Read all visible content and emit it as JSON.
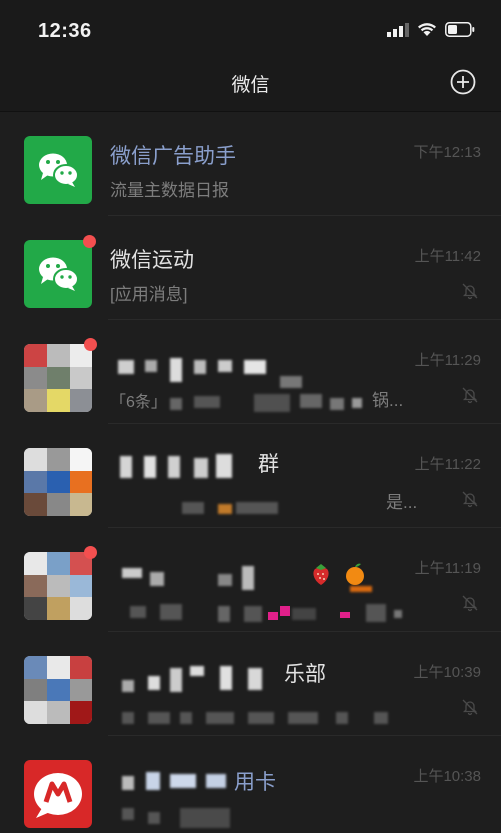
{
  "status_bar": {
    "time": "12:36"
  },
  "nav": {
    "title": "微信"
  },
  "chats": [
    {
      "title": "微信广告助手",
      "preview": "流量主数据日报",
      "time": "下午12:13",
      "muted": false
    },
    {
      "title": "微信运动",
      "preview": "[应用消息]",
      "time": "上午11:42",
      "muted": true,
      "unread": true
    },
    {
      "title": "",
      "preview_start": "「6条」",
      "preview_end": "锅...",
      "time": "上午11:29",
      "muted": true,
      "unread": true
    },
    {
      "title_end": "群",
      "preview_end": "是...",
      "time": "上午11:22",
      "muted": true
    },
    {
      "title": "",
      "preview": "",
      "time": "上午11:19",
      "muted": true,
      "unread": true
    },
    {
      "title_end": "乐部",
      "preview": "",
      "time": "上午10:39",
      "muted": true
    },
    {
      "title_end": "用卡",
      "preview": "",
      "time": "上午10:38",
      "muted": false
    }
  ],
  "icons": {
    "signal": "signal-icon",
    "wifi": "wifi-icon",
    "battery": "battery-icon",
    "add": "plus-circle-icon",
    "mute": "bell-off-icon"
  },
  "colors": {
    "wechat_green": "#22a948",
    "badge_red": "#f34f4f",
    "service_blue": "#8a9fcc"
  }
}
